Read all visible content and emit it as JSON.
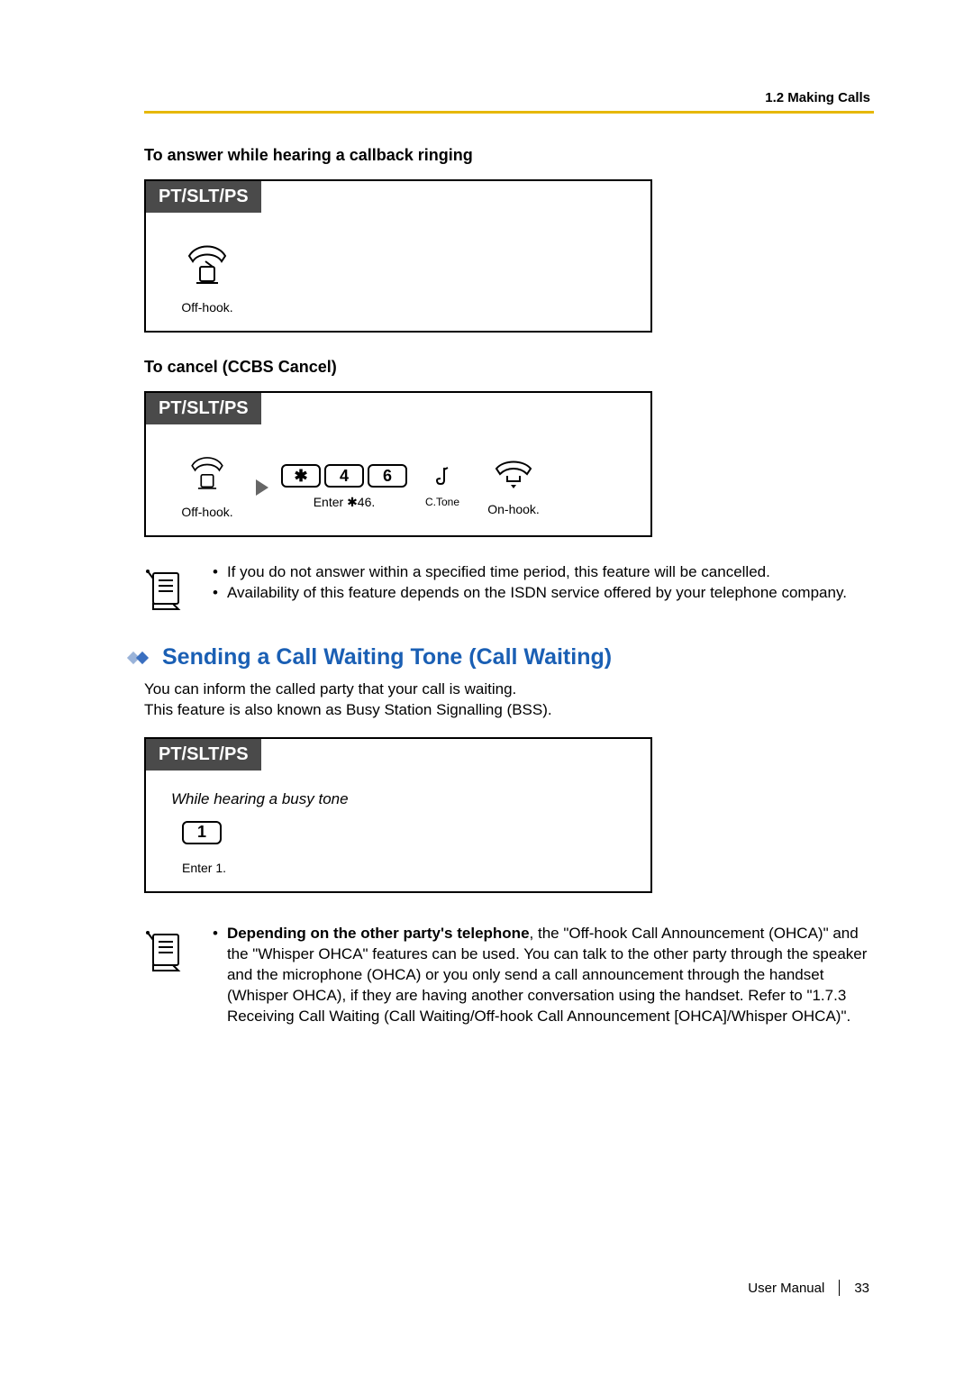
{
  "header": {
    "breadcrumb": "1.2 Making Calls"
  },
  "sec1": {
    "title": "To answer while hearing a callback ringing",
    "tab": "PT/SLT/PS",
    "step1_label": "Off-hook."
  },
  "sec2": {
    "title": "To cancel (CCBS Cancel)",
    "tab": "PT/SLT/PS",
    "step1_label": "Off-hook.",
    "keys": {
      "star": "✱",
      "k4": "4",
      "k6": "6"
    },
    "step2_label": "Enter ✱46.",
    "ctone": "C.Tone",
    "step3_label": "On-hook."
  },
  "note1": {
    "b1": "If you do not answer within a specified time period, this feature will be cancelled.",
    "b2": "Availability of this feature depends on the ISDN service offered by your telephone company."
  },
  "sec3": {
    "title": "Sending a Call Waiting Tone (Call Waiting)",
    "intro1": "You can inform the called party that your call is waiting.",
    "intro2": "This feature is also known as Busy Station Signalling (BSS).",
    "tab": "PT/SLT/PS",
    "instruction": "While hearing a busy tone",
    "key1": "1",
    "step_label": "Enter 1."
  },
  "note2": {
    "bold": "Depending on the other party's telephone",
    "rest": ", the \"Off-hook Call Announcement (OHCA)\" and the \"Whisper OHCA\" features can be used. You can talk to the other party through the speaker and the microphone (OHCA) or you only send a call announcement through the handset (Whisper OHCA), if they are having another conversation using the handset. Refer to \"1.7.3 Receiving Call Waiting (Call Waiting/Off-hook Call Announcement [OHCA]/Whisper OHCA)\"."
  },
  "footer": {
    "label": "User Manual",
    "page": "33"
  }
}
